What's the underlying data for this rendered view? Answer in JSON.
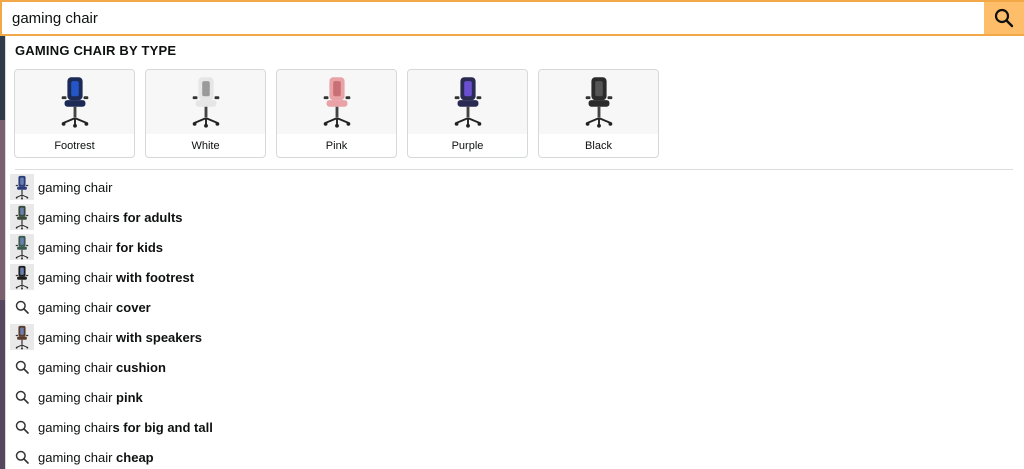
{
  "search": {
    "value": "gaming chair",
    "button_icon": "search-icon",
    "accent_border": "#f3a847",
    "button_color": "#febd69"
  },
  "type_section": {
    "title": "GAMING CHAIR BY TYPE",
    "cards": [
      {
        "label": "Footrest",
        "seat_color": "#1c2a55",
        "accent": "#2456c8"
      },
      {
        "label": "White",
        "seat_color": "#e6e6e6",
        "accent": "#9a9a9a"
      },
      {
        "label": "Pink",
        "seat_color": "#e9a3a6",
        "accent": "#c96f76"
      },
      {
        "label": "Purple",
        "seat_color": "#2a2a52",
        "accent": "#6a4fd1"
      },
      {
        "label": "Black",
        "seat_color": "#2b2b2b",
        "accent": "#555555"
      }
    ]
  },
  "suggestions": [
    {
      "prefix": "gaming chair",
      "bold": "",
      "icon": "chair-thumbnail-icon",
      "chair_color": "#2a3d7a"
    },
    {
      "prefix": "gaming chair",
      "bold": "s for adults",
      "icon": "chair-thumbnail-icon",
      "chair_color": "#3a4a3a"
    },
    {
      "prefix": "gaming chair",
      "bold": " for kids",
      "icon": "chair-thumbnail-icon",
      "chair_color": "#3b5b4e"
    },
    {
      "prefix": "gaming chair",
      "bold": " with footrest",
      "icon": "chair-thumbnail-icon",
      "chair_color": "#1e1e1e"
    },
    {
      "prefix": "gaming chair",
      "bold": " cover",
      "icon": "search-icon"
    },
    {
      "prefix": "gaming chair",
      "bold": " with speakers",
      "icon": "chair-thumbnail-icon",
      "chair_color": "#5a3b2b"
    },
    {
      "prefix": "gaming chair",
      "bold": " cushion",
      "icon": "search-icon"
    },
    {
      "prefix": "gaming chair",
      "bold": " pink",
      "icon": "search-icon"
    },
    {
      "prefix": "gaming chair",
      "bold": "s for big and tall",
      "icon": "search-icon"
    },
    {
      "prefix": "gaming chair",
      "bold": " cheap",
      "icon": "search-icon"
    }
  ]
}
